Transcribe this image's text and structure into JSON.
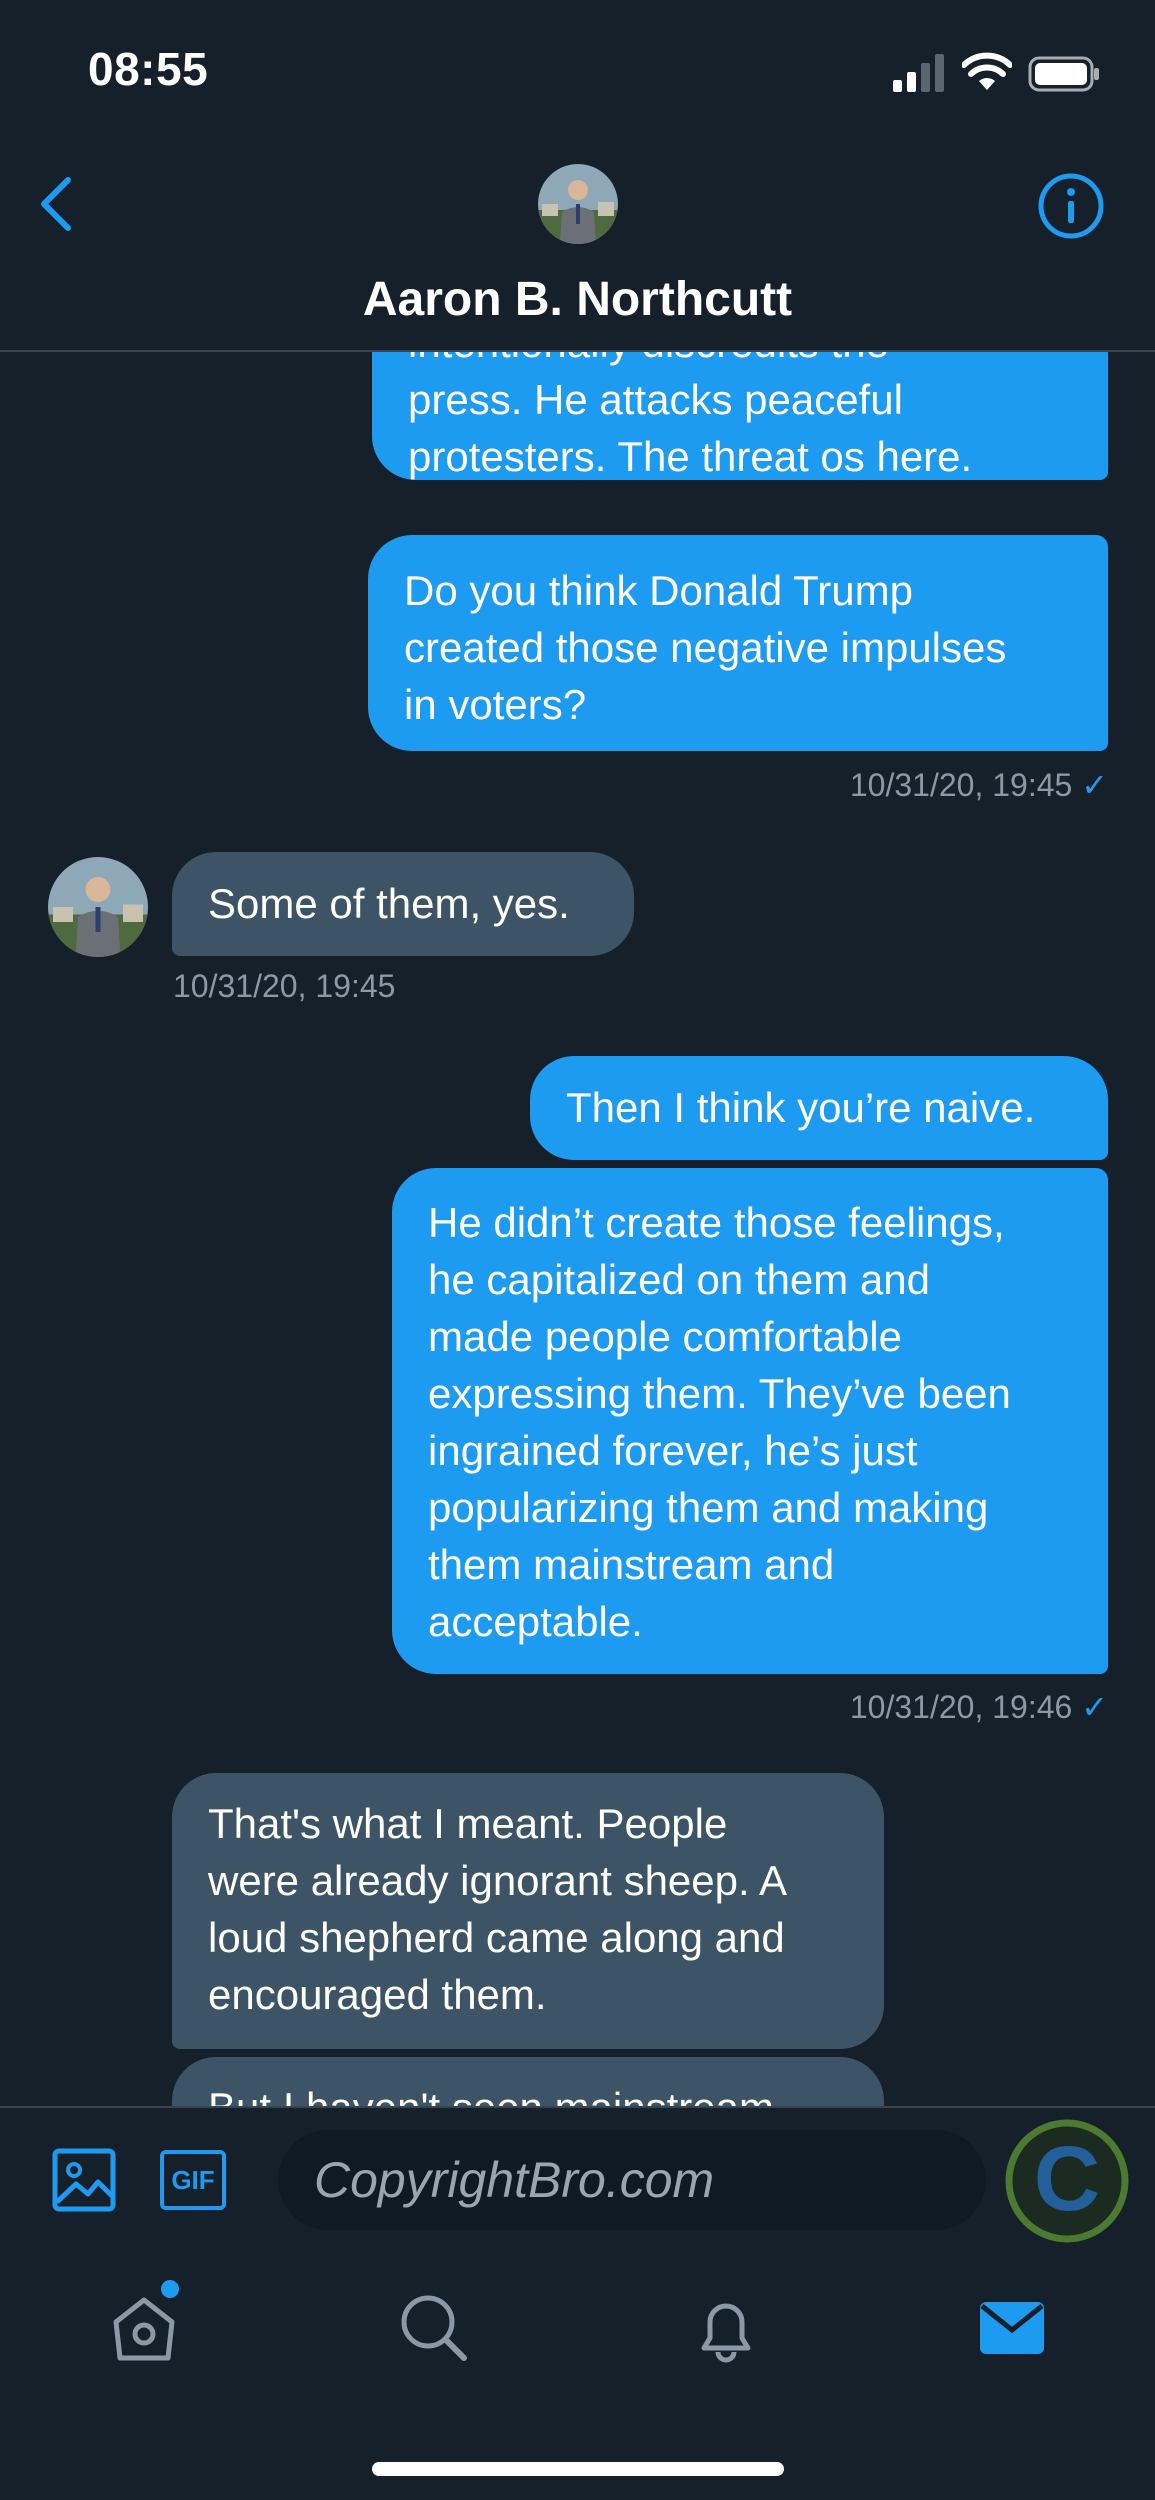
{
  "status_bar": {
    "time": "08:55"
  },
  "header": {
    "title": "Aaron B. Northcutt"
  },
  "messages": [
    {
      "direction": "outgoing",
      "lines": [
        "intentionally discredits the",
        "press. He attacks peaceful",
        "protesters. The threat os here."
      ]
    },
    {
      "direction": "outgoing",
      "lines": [
        "Do you think Donald Trump",
        "created those negative impulses",
        "in voters?"
      ],
      "timestamp": "10/31/20, 19:45",
      "read_mark": "✓"
    },
    {
      "direction": "incoming",
      "lines": [
        "Some of them, yes."
      ],
      "timestamp": "10/31/20, 19:45"
    },
    {
      "direction": "outgoing",
      "lines": [
        "Then I think you’re naive."
      ]
    },
    {
      "direction": "outgoing",
      "lines": [
        "He didn’t create those feelings,",
        "he capitalized on them and",
        "made people comfortable",
        "expressing them. They’ve been",
        "ingrained forever, he’s just",
        "popularizing them and making",
        "them mainstream and",
        "acceptable."
      ],
      "timestamp": "10/31/20, 19:46",
      "read_mark": "✓"
    },
    {
      "direction": "incoming",
      "lines": [
        "That's what I meant. People",
        "were already ignorant sheep. A",
        "loud shepherd came along and",
        "encouraged them."
      ]
    },
    {
      "direction": "incoming",
      "lines": [
        "But I haven't seen mainstream"
      ]
    }
  ],
  "compose": {
    "image_icon": "image-icon",
    "gif_label": "GIF",
    "input_value": "CopyrightBro.com",
    "watermark_letter": "C"
  },
  "tab_bar": {
    "items": [
      "home-icon",
      "search-icon",
      "bell-icon",
      "mail-icon"
    ],
    "active": "mail-icon"
  },
  "colors": {
    "background": "#15202b",
    "accent": "#1d9bf0",
    "incoming_bubble": "#3d5466",
    "meta_text": "#8b98a5"
  }
}
